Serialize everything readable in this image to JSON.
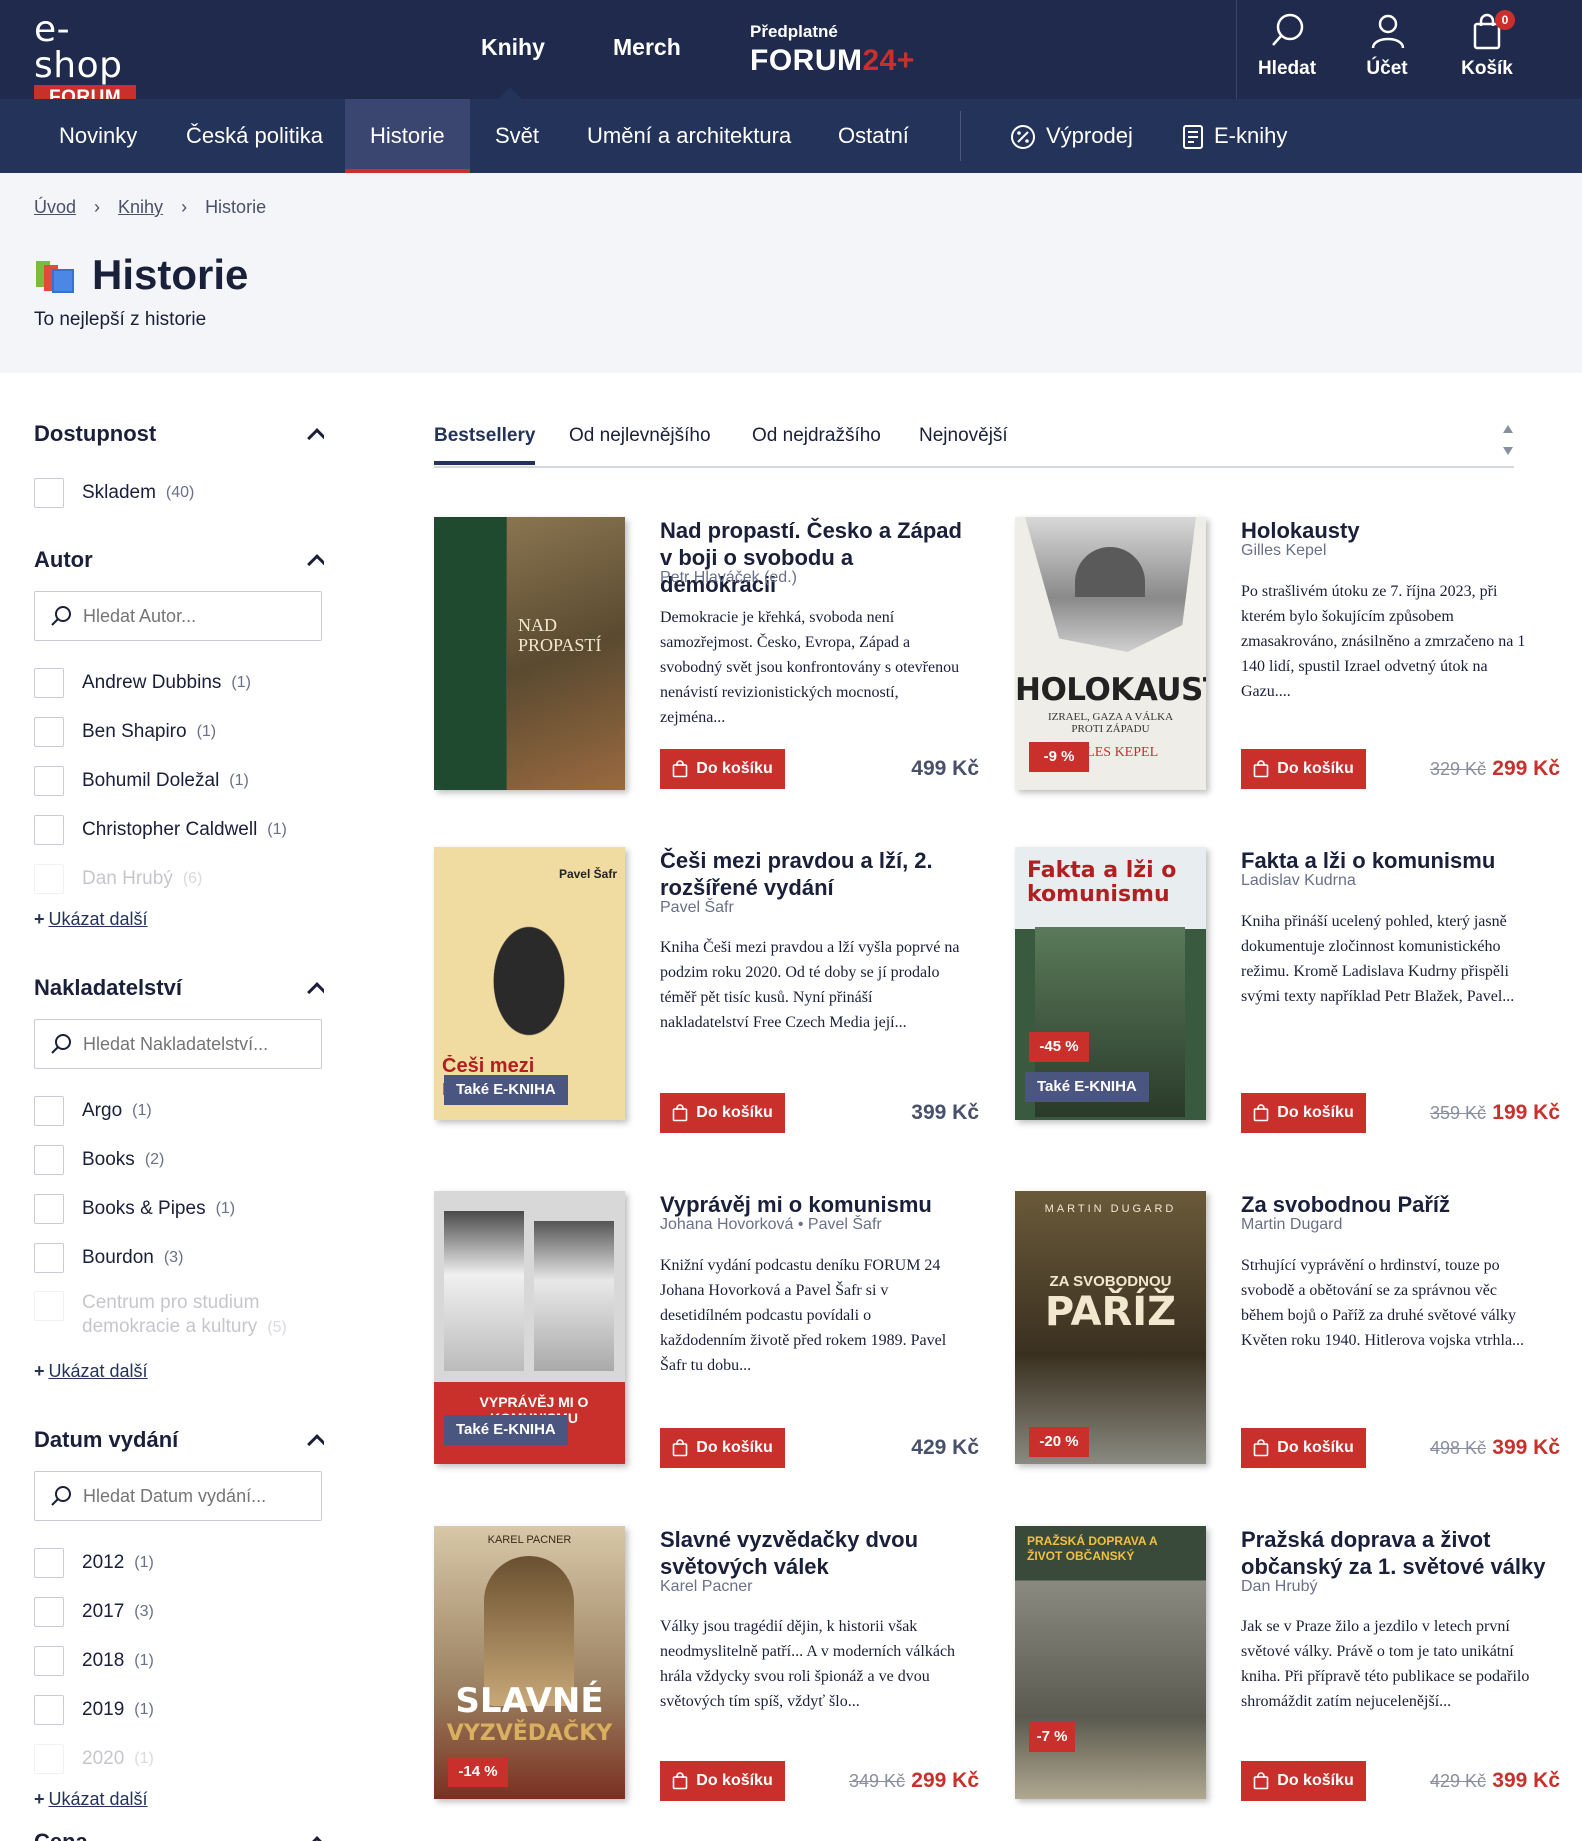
{
  "brand": {
    "top": "e-shop",
    "badge": "FORUM"
  },
  "topnav": {
    "books": "Knihy",
    "merch": "Merch",
    "sub_small": "Předplatné",
    "sub_big": "FORUM",
    "sub_accent": "24+"
  },
  "tools": {
    "search": "Hledat",
    "account": "Účet",
    "cart": "Košík",
    "cart_count": "0"
  },
  "categories": [
    "Novinky",
    "Česká politika",
    "Historie",
    "Svět",
    "Umění a architektura",
    "Ostatní"
  ],
  "specials": {
    "sale": "Výprodej",
    "ebooks": "E-knihy"
  },
  "breadcrumb": [
    "Úvod",
    "Knihy",
    "Historie"
  ],
  "page": {
    "title": "Historie",
    "subtitle": "To nejlepší z historie"
  },
  "filters": {
    "availability": {
      "title": "Dostupnost",
      "items": [
        {
          "label": "Skladem",
          "count": "(40)"
        }
      ]
    },
    "author": {
      "title": "Autor",
      "placeholder": "Hledat Autor...",
      "items": [
        {
          "label": "Andrew Dubbins",
          "count": "(1)"
        },
        {
          "label": "Ben Shapiro",
          "count": "(1)"
        },
        {
          "label": "Bohumil Doležal",
          "count": "(1)"
        },
        {
          "label": "Christopher Caldwell",
          "count": "(1)"
        },
        {
          "label": "Dan Hrubý",
          "count": "(6)"
        }
      ]
    },
    "publisher": {
      "title": "Nakladatelství",
      "placeholder": "Hledat Nakladatelství...",
      "items": [
        {
          "label": "Argo",
          "count": "(1)"
        },
        {
          "label": "Books",
          "count": "(2)"
        },
        {
          "label": "Books & Pipes",
          "count": "(1)"
        },
        {
          "label": "Bourdon",
          "count": "(3)"
        },
        {
          "label": "Centrum pro studium demokracie a kultury",
          "count": "(5)"
        }
      ]
    },
    "date": {
      "title": "Datum vydání",
      "placeholder": "Hledat Datum vydání...",
      "items": [
        {
          "label": "2012",
          "count": "(1)"
        },
        {
          "label": "2017",
          "count": "(3)"
        },
        {
          "label": "2018",
          "count": "(1)"
        },
        {
          "label": "2019",
          "count": "(1)"
        },
        {
          "label": "2020",
          "count": "(1)"
        }
      ]
    },
    "price": {
      "title": "Cena"
    },
    "show_more": "Ukázat další"
  },
  "sort_tabs": [
    "Bestsellery",
    "Od nejlevnějšího",
    "Od nejdražšího",
    "Nejnovější"
  ],
  "buy_label": "Do košíku",
  "ebook_label": "Také E-KNIHA",
  "products": [
    {
      "title": "Nad propastí. Česko a Západ v boji o svobodu a demokracii",
      "author": "Petr Hlaváček (ed.)",
      "desc": "Demokracie je křehká, svoboda není samozřejmost. Česko, Evropa, Západ a svobodný svět jsou konfrontovány s otevřenou nenávistí revizionistických mocností, zejména...",
      "price": "499 Kč",
      "old_price": "",
      "discount": "",
      "cover_title": "NAD PROPASTÍ"
    },
    {
      "title": "Holokausty",
      "author": "Gilles Kepel",
      "desc": "Po strašlivém útoku ze 7. října 2023, při kterém bylo šokujícím způsobem zmasakrováno, znásilněno a zmrzačeno na 1 140 lidí, spustil Izrael odvetný útok na Gazu....",
      "price": "299 Kč",
      "old_price": "329 Kč",
      "discount": "-9 %",
      "cover_title": "HOLOKAUSTY",
      "cover_sub": "IZRAEL, GAZA A VÁLKA PROTI ZÁPADU",
      "cover_author": "GILLES KEPEL"
    },
    {
      "title": "Češi mezi pravdou a lží, 2. rozšířené vydání",
      "author": "Pavel Šafr",
      "desc": "Kniha Češi mezi pravdou a lží vyšla poprvé na podzim roku 2020. Od té doby se jí prodalo téměř pět tisíc kusů. Nyní přináší nakladatelství Free Czech Media její...",
      "price": "399 Kč",
      "old_price": "",
      "discount": "",
      "cover_title": "Češi mezi pravdou a lží",
      "cover_author": "Pavel Šafr"
    },
    {
      "title": "Fakta a lži o komunismu",
      "author": "Ladislav Kudrna",
      "desc": "Kniha přináší ucelený pohled, který jasně dokumentuje zločinnost komunistického režimu. Kromě Ladislava Kudrny přispěli svými texty například Petr Blažek, Pavel...",
      "price": "199 Kč",
      "old_price": "359 Kč",
      "discount": "-45 %",
      "cover_title": "Fakta a lži o komunismu"
    },
    {
      "title": "Vyprávěj mi o komunismu",
      "author": "Johana Hovorková • Pavel Šafr",
      "desc": "Knižní vydání podcastu deníku FORUM 24 Johana Hovorková a Pavel Šafr si v desetidílném podcastu povídali o každodenním životě před rokem 1989. Pavel Šafr tu dobu...",
      "price": "429 Kč",
      "old_price": "",
      "discount": "",
      "cover_title": "VYPRÁVĚJ MI O KOMUNISMU"
    },
    {
      "title": "Za svobodnou Paříž",
      "author": "Martin Dugard",
      "desc": "Strhující vyprávění o hrdinství, touze po svobodě a obětování se za správnou věc během bojů o Paříž za druhé světové války Květen roku 1940. Hitlerova vojska vtrhla...",
      "price": "399 Kč",
      "old_price": "498 Kč",
      "discount": "-20 %",
      "cover_title": "PAŘÍŽ",
      "cover_top": "ZA SVOBODNOU",
      "cover_author": "MARTIN DUGARD"
    },
    {
      "title": "Slavné vyzvědačky dvou světových válek",
      "author": "Karel Pacner",
      "desc": "Války jsou tragédií dějin, k historii však neodmyslitelně patří... A v moderních válkách hrála vždycky svou roli špionáž a ve dvou světových tím spíš, vždyť šlo...",
      "price": "299 Kč",
      "old_price": "349 Kč",
      "discount": "-14 %",
      "cover_title": "SLAVNÉ",
      "cover_sub": "VYZVĚDAČKY",
      "cover_author": "KAREL PACNER"
    },
    {
      "title": "Pražská doprava a život občanský za 1. světové války",
      "author": "Dan Hrubý",
      "desc": "Jak se v Praze žilo a jezdilo v letech první světové války. Právě o tom je tato unikátní kniha. Při přípravě této publikace se podařilo shromáždit zatím nejucelenější...",
      "price": "399 Kč",
      "old_price": "429 Kč",
      "discount": "-7 %",
      "cover_title": "PRAŽSKÁ DOPRAVA A ŽIVOT OBČANSKÝ"
    }
  ],
  "colors": {
    "navy": "#1f2a4d",
    "navy_light": "#24335a",
    "red": "#c9302c"
  }
}
